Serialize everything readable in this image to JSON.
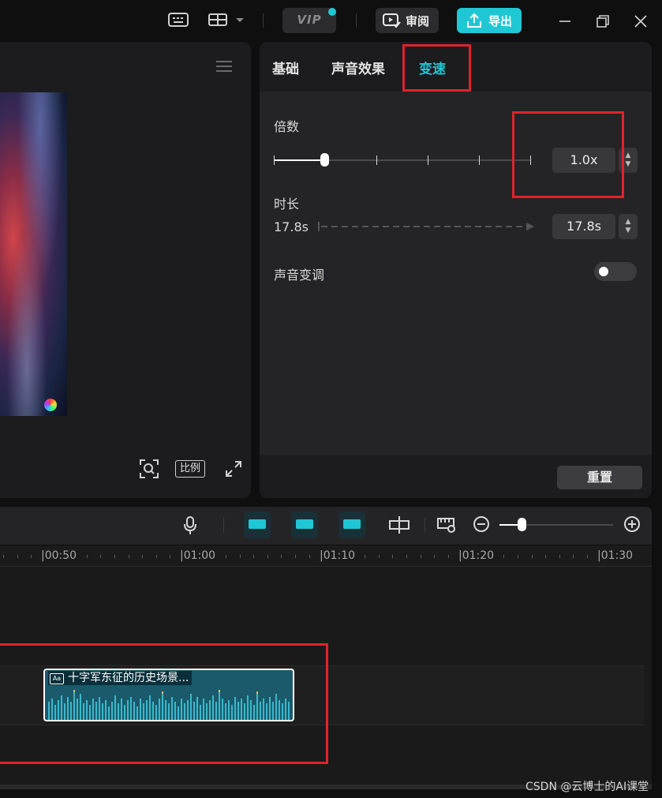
{
  "titlebar": {
    "vip_label": "VIP",
    "review_label": "审阅",
    "export_label": "导出",
    "accent_color": "#1fc7d4"
  },
  "preview": {
    "ratio_label": "比例"
  },
  "panel": {
    "tabs": [
      {
        "label": "基础",
        "active": false
      },
      {
        "label": "声音效果",
        "active": false
      },
      {
        "label": "变速",
        "active": true
      }
    ],
    "speed": {
      "label": "倍数",
      "value": "1.0x",
      "slider_position": 0.16
    },
    "duration": {
      "label": "时长",
      "original": "17.8s",
      "value": "17.8s"
    },
    "pitch": {
      "label": "声音变调",
      "enabled": false
    },
    "reset_label": "重置"
  },
  "timeline": {
    "ruler": [
      "|00:50",
      "|01:00",
      "|01:10",
      "|01:20",
      "|01:30"
    ],
    "zoom_level": 0.2,
    "clip": {
      "title": "十字军东征的历史场景..."
    }
  },
  "watermark": "CSDN @云博士的AI课堂"
}
